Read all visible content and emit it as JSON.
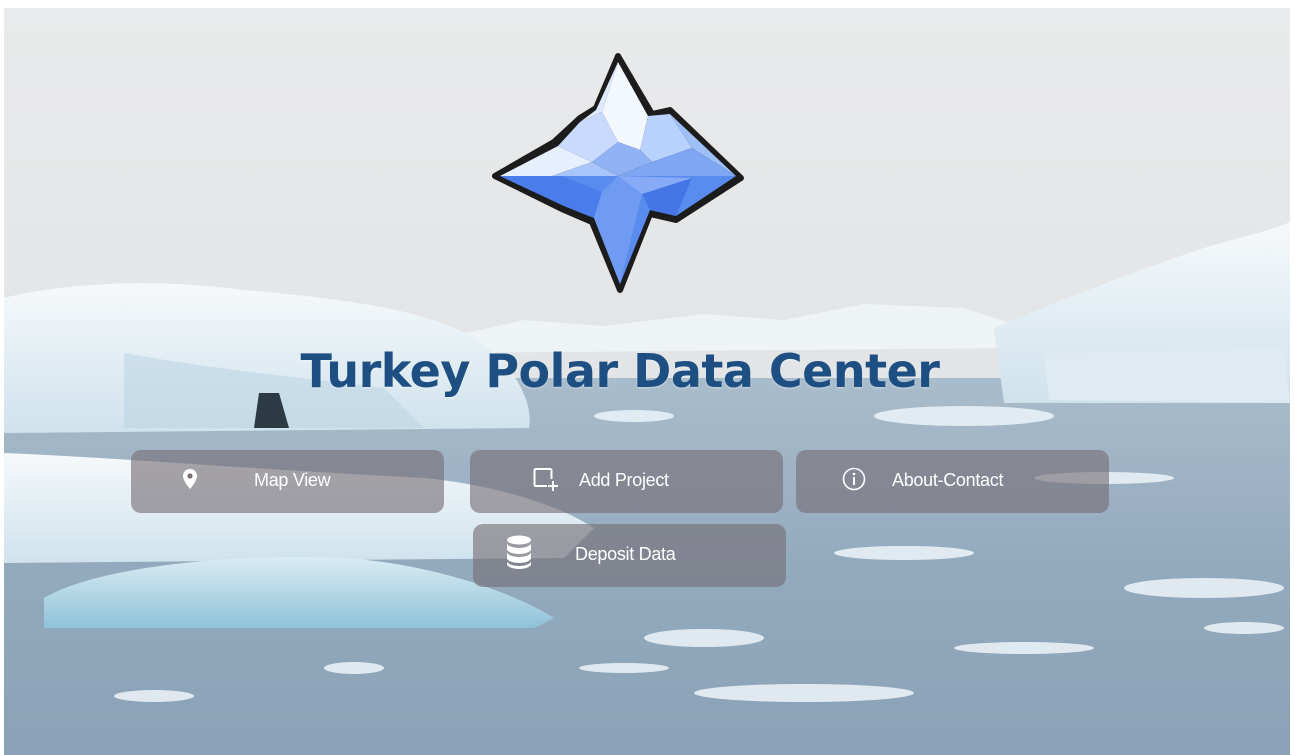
{
  "site": {
    "title": "Turkey Polar Data Center"
  },
  "logo": {
    "icon": "iceberg-logo-icon"
  },
  "nav": {
    "buttons": [
      {
        "label": "Map View",
        "icon": "map-pin-icon"
      },
      {
        "label": "Add Project",
        "icon": "add-project-icon"
      },
      {
        "label": "About-Contact",
        "icon": "info-circle-icon"
      },
      {
        "label": "Deposit Data",
        "icon": "database-icon"
      }
    ]
  },
  "colors": {
    "title": "#1e4f83",
    "button_bg": "#766e74",
    "button_text": "#ffffff",
    "logo_light": "#cfe0ff",
    "logo_mid": "#7aa6f5",
    "logo_dark": "#3f73e8"
  }
}
